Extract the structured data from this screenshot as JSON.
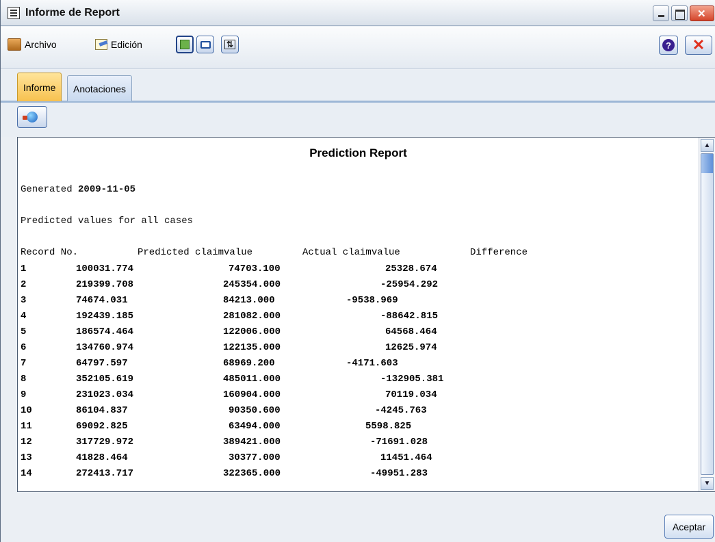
{
  "window": {
    "title": "Informe de Report",
    "icon": "report-icon"
  },
  "menu": {
    "archivo": "Archivo",
    "edicion": "Edición"
  },
  "tabs": [
    {
      "label": "Informe",
      "active": true
    },
    {
      "label": "Anotaciones",
      "active": false
    }
  ],
  "report": {
    "title": "Prediction Report",
    "generated_label": "Generated",
    "generated_date": "2009-11-05",
    "subtitle": "Predicted values for all cases",
    "columns": [
      "Record No.",
      "Predicted claimvalue",
      "Actual claimvalue",
      "Difference"
    ],
    "rows": [
      [
        "1",
        "100031.774",
        "74703.100",
        "25328.674"
      ],
      [
        "2",
        "219399.708",
        "245354.000",
        "-25954.292"
      ],
      [
        "3",
        "74674.031",
        "84213.000",
        "-9538.969"
      ],
      [
        "4",
        "192439.185",
        "281082.000",
        "-88642.815"
      ],
      [
        "5",
        "186574.464",
        "122006.000",
        "64568.464"
      ],
      [
        "6",
        "134760.974",
        "122135.000",
        "12625.974"
      ],
      [
        "7",
        "64797.597",
        "68969.200",
        "-4171.603"
      ],
      [
        "8",
        "352105.619",
        "485011.000",
        "-132905.381"
      ],
      [
        "9",
        "231023.034",
        "160904.000",
        "70119.034"
      ],
      [
        "10",
        "86104.837",
        "90350.600",
        "-4245.763"
      ],
      [
        "11",
        "69092.825",
        "63494.000",
        "5598.825"
      ],
      [
        "12",
        "317729.972",
        "389421.000",
        "-71691.028"
      ],
      [
        "13",
        "41828.464",
        "30377.000",
        "11451.464"
      ],
      [
        "14",
        "272413.717",
        "322365.000",
        "-49951.283"
      ]
    ]
  },
  "buttons": {
    "ok": "Aceptar"
  },
  "colors": {
    "active_tab": "#f7c14f",
    "toolbar_border": "#4b6fa8",
    "close_red": "#e0301e"
  }
}
